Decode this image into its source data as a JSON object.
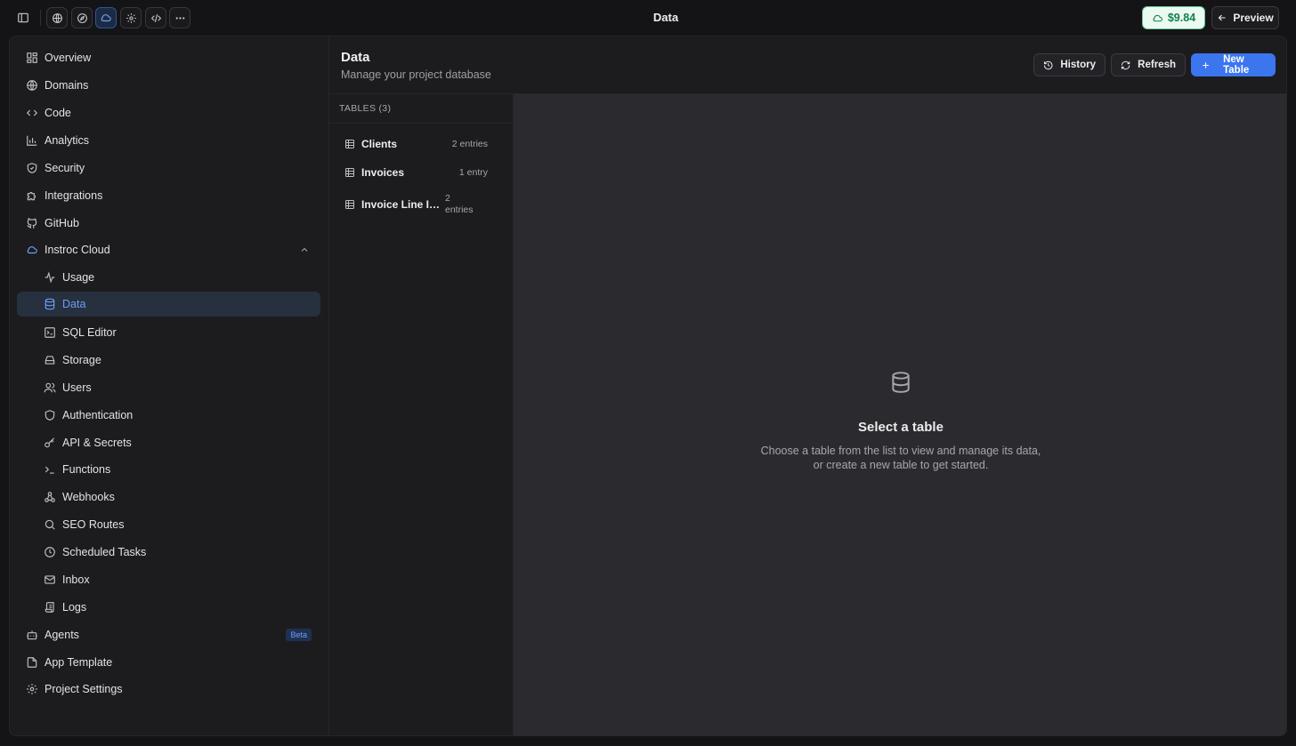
{
  "topbar": {
    "title": "Data",
    "icons": [
      "sidebar-toggle-icon",
      "globe-icon",
      "compass-icon",
      "cloud-icon",
      "gear-icon",
      "code-icon",
      "more-icon"
    ],
    "balance": "$9.84",
    "preview_label": "Preview"
  },
  "sidebar": {
    "items": [
      {
        "label": "Overview",
        "icon": "layout-icon"
      },
      {
        "label": "Domains",
        "icon": "globe-icon"
      },
      {
        "label": "Code",
        "icon": "code-icon"
      },
      {
        "label": "Analytics",
        "icon": "bar-chart-icon"
      },
      {
        "label": "Security",
        "icon": "shield-check-icon"
      },
      {
        "label": "Integrations",
        "icon": "puzzle-icon"
      },
      {
        "label": "GitHub",
        "icon": "github-icon"
      },
      {
        "label": "Instroc Cloud",
        "icon": "cloud-icon",
        "expanded": true
      }
    ],
    "sub_items": [
      {
        "label": "Usage",
        "icon": "activity-icon"
      },
      {
        "label": "Data",
        "icon": "database-icon",
        "active": true
      },
      {
        "label": "SQL Editor",
        "icon": "terminal-square-icon"
      },
      {
        "label": "Storage",
        "icon": "hard-drive-icon"
      },
      {
        "label": "Users",
        "icon": "users-icon"
      },
      {
        "label": "Authentication",
        "icon": "shield-icon"
      },
      {
        "label": "API & Secrets",
        "icon": "key-icon"
      },
      {
        "label": "Functions",
        "icon": "terminal-icon"
      },
      {
        "label": "Webhooks",
        "icon": "webhook-icon"
      },
      {
        "label": "SEO Routes",
        "icon": "search-icon"
      },
      {
        "label": "Scheduled Tasks",
        "icon": "clock-icon"
      },
      {
        "label": "Inbox",
        "icon": "mail-icon"
      },
      {
        "label": "Logs",
        "icon": "scroll-icon"
      }
    ],
    "bottom_items": [
      {
        "label": "Agents",
        "icon": "bot-icon",
        "badge": "Beta"
      },
      {
        "label": "App Template",
        "icon": "file-icon"
      },
      {
        "label": "Project Settings",
        "icon": "gear-icon"
      }
    ]
  },
  "header": {
    "title": "Data",
    "subtitle": "Manage your project database",
    "history_label": "History",
    "refresh_label": "Refresh",
    "new_table_label": "New Table"
  },
  "tables": {
    "heading": "TABLES (3)",
    "rows": [
      {
        "name": "Clients",
        "count": "2 entries"
      },
      {
        "name": "Invoices",
        "count": "1 entry"
      },
      {
        "name": "Invoice Line Ite...",
        "count": "2 entries"
      }
    ]
  },
  "empty_state": {
    "icon": "database-icon",
    "title": "Select a table",
    "desc_line1": "Choose a table from the list to view and manage its data,",
    "desc_line2": "or create a new table to get started."
  },
  "colors": {
    "accent": "#3b76ef",
    "active_text": "#6f9cf3",
    "balance_green": "#11804e"
  }
}
